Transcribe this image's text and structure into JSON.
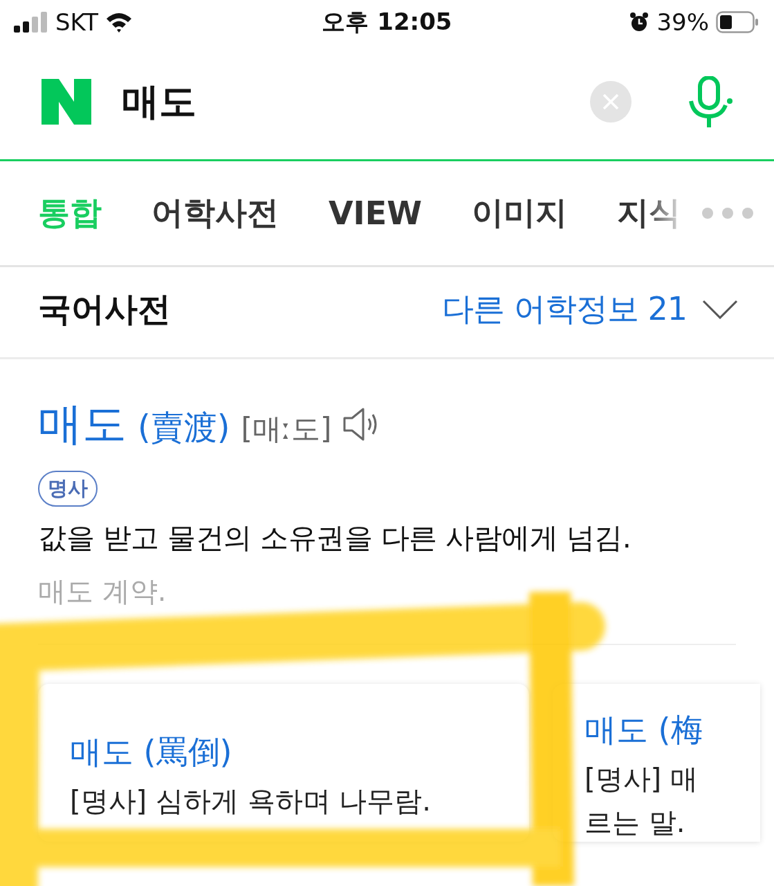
{
  "status_bar": {
    "carrier": "SKT",
    "time": "오후 12:05",
    "battery": "39%"
  },
  "search": {
    "value": "매도"
  },
  "tabs": [
    {
      "label": "통합",
      "selected": true
    },
    {
      "label": "어학사전",
      "selected": false
    },
    {
      "label": "VIEW",
      "selected": false
    },
    {
      "label": "이미지",
      "selected": false
    },
    {
      "label": "지식",
      "selected": false
    }
  ],
  "dictionary": {
    "title": "국어사전",
    "other_info": "다른 어학정보 21"
  },
  "entry": {
    "word": "매도",
    "hanja": "(賣渡)",
    "pronunciation": "[매ː도]",
    "part_of_speech": "명사",
    "definition": "값을 받고 물건의 소유권을 다른 사람에게 넘김.",
    "example": "매도 계약."
  },
  "related": [
    {
      "title": "매도 (罵倒)",
      "lines": [
        "[명사] 심하게 욕하며 나무람."
      ]
    },
    {
      "title": "매도 (梅",
      "lines": [
        "[명사] 매",
        "르는 말."
      ]
    }
  ]
}
